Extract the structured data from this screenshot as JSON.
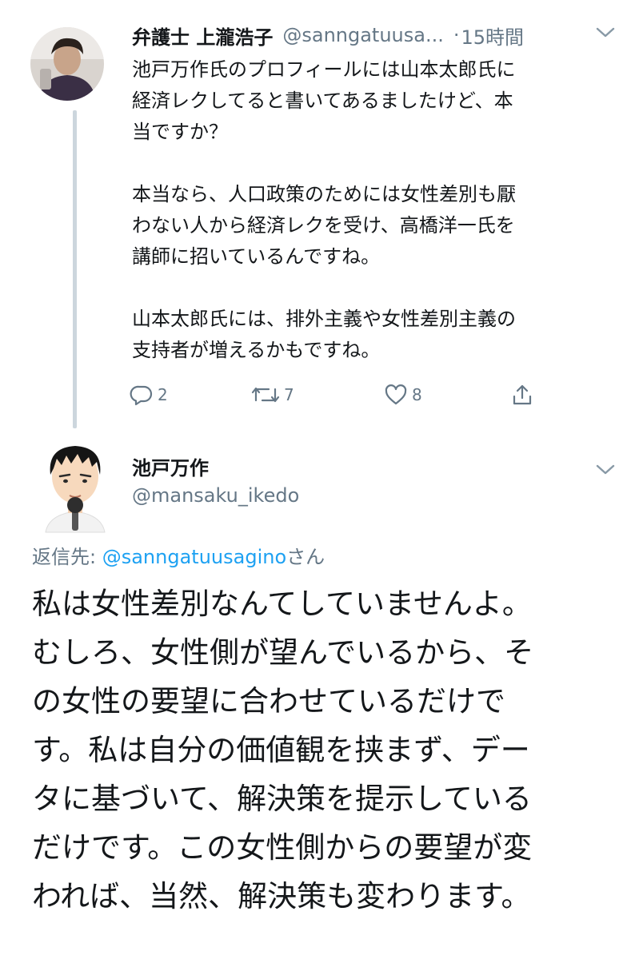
{
  "parent_tweet": {
    "display_name": "弁護士 上瀧浩子",
    "handle": "@sanngatuusa...",
    "separator": "·",
    "time": "15時間",
    "paragraphs": [
      [
        "池戸万作氏のプロフィールには山本太郎氏に",
        "経済レクしてると書いてあるましたけど、本",
        "当ですか？"
      ],
      [
        "本当なら、人口政策のためには女性差別も厭",
        "わない人から経済レクを受け、高橋洋一氏を",
        "講師に招いているんですね。"
      ],
      [
        "山本太郎氏には、排外主義や女性差別主義の",
        "支持者が増えるかもですね。"
      ]
    ],
    "actions": {
      "reply_count": "2",
      "retweet_count": "7",
      "like_count": "8"
    },
    "icons": [
      "reply-icon",
      "retweet-icon",
      "like-icon",
      "share-icon",
      "chevron-down-icon"
    ]
  },
  "reply_tweet": {
    "display_name": "池戸万作",
    "handle": "@mansaku_ikedo",
    "reply_to_prefix": "返信先: ",
    "reply_to_handle": "@sanngatuusagino",
    "reply_to_suffix": "さん",
    "lines": [
      "私は女性差別なんてしていませんよ。",
      "むしろ、女性側が望んでいるから、そ",
      "の女性の要望に合わせているだけで",
      "す。私は自分の価値観を挟まず、デー",
      "タに基づいて、解決策を提示している",
      "だけです。この女性側からの要望が変",
      "われば、当然、解決策も変わります。"
    ]
  },
  "colors": {
    "text": "#14171a",
    "secondary": "#657786",
    "link": "#1da1f2",
    "thread_line": "#ccd6dd"
  }
}
